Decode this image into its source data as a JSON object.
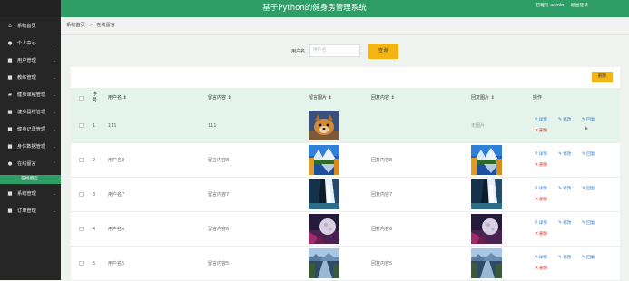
{
  "header": {
    "title": "基于Python的健身房管理系统",
    "user": "管理员 admin",
    "logout": "退出登录"
  },
  "sidebar": {
    "items": [
      {
        "label": "系统首页",
        "icon": "home-icon",
        "glyph": "⌂",
        "chevron": ""
      },
      {
        "label": "个人中心",
        "icon": "user-icon",
        "glyph": "●",
        "chevron": "⌄"
      },
      {
        "label": "用户管理",
        "icon": "grid-icon",
        "glyph": "■",
        "chevron": "⌄"
      },
      {
        "label": "教练管理",
        "icon": "grid-icon",
        "glyph": "■",
        "chevron": "⌄"
      },
      {
        "label": "健身课程管理",
        "icon": "bookmark-icon",
        "glyph": "▰",
        "chevron": "⌄"
      },
      {
        "label": "健身器材管理",
        "icon": "grid-icon",
        "glyph": "■",
        "chevron": "⌄"
      },
      {
        "label": "健身记录管理",
        "icon": "grid-icon",
        "glyph": "■",
        "chevron": "⌄"
      },
      {
        "label": "身体数据管理",
        "icon": "grid-icon",
        "glyph": "■",
        "chevron": "⌄"
      },
      {
        "label": "在线留言",
        "icon": "pin-icon",
        "glyph": "●",
        "chevron": "⌃"
      },
      {
        "label": "系统管理",
        "icon": "grid-icon",
        "glyph": "■",
        "chevron": "⌄"
      },
      {
        "label": "订单管理",
        "icon": "grid-icon",
        "glyph": "■",
        "chevron": "⌄"
      }
    ],
    "sub_item": "在线留言"
  },
  "breadcrumb": {
    "home": "系统首页",
    "sep": ">",
    "current": "在线留言"
  },
  "search": {
    "label": "用户名",
    "placeholder": "用户名",
    "button": "查询"
  },
  "delete_button": "删除",
  "table": {
    "headers": {
      "index": "序号",
      "username": "用户名",
      "message": "留言内容",
      "message_img": "留言图片",
      "reply": "回复内容",
      "reply_img": "回复图片",
      "ops": "操作"
    },
    "sort_mark": "⇕",
    "ops": {
      "detail": "详情",
      "edit": "修改",
      "reply": "回复",
      "delete": "删除"
    },
    "op_icons": {
      "detail": "⚲",
      "edit": "✎",
      "reply": "✎",
      "delete": "✕"
    },
    "rows": [
      {
        "index": "1",
        "username": "111",
        "message": "111",
        "reply": "",
        "reply_img": "无图片",
        "msg_img": "dog",
        "rep_img": ""
      },
      {
        "index": "2",
        "username": "用户名8",
        "message": "留言内容8",
        "reply": "回复内容8",
        "reply_img": "",
        "msg_img": "lake",
        "rep_img": "lake"
      },
      {
        "index": "3",
        "username": "用户名7",
        "message": "留言内容7",
        "reply": "回复内容7",
        "reply_img": "",
        "msg_img": "waterfall",
        "rep_img": "waterfall"
      },
      {
        "index": "4",
        "username": "用户名6",
        "message": "留言内容6",
        "reply": "回复内容6",
        "reply_img": "",
        "msg_img": "moon",
        "rep_img": "moon"
      },
      {
        "index": "5",
        "username": "用户名5",
        "message": "留言内容5",
        "reply": "回复内容5",
        "reply_img": "",
        "msg_img": "river",
        "rep_img": "river"
      }
    ]
  },
  "colors": {
    "accent": "#2f9d66",
    "button": "#f3b515",
    "sidebar": "#262626",
    "link": "#2f7fd0",
    "danger": "#d9352a"
  }
}
